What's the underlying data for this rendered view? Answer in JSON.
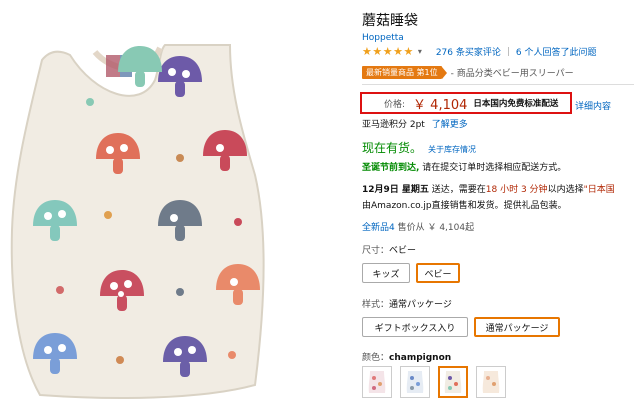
{
  "product": {
    "title": "蘑菇睡袋",
    "brand": "Hoppetta",
    "stars": "★★★★★",
    "reviews": "276 条买家评论",
    "qa": "6 个人回答了此问题",
    "badge": "最新销量商品 第1位",
    "rank_category": "- 商品分类ベビー用スリーパー",
    "price_label": "价格:",
    "price": "￥ 4,104",
    "shipping": "日本国内免费标准配送",
    "details_link": "详细内容",
    "points": "亚马逊积分 2pt",
    "points_link": "了解更多",
    "stock": "现在有货。",
    "stock_link": "关于库存情况",
    "xmas_label": "圣诞节前到达,",
    "xmas_text": "请在提交订单时选择相应配送方式。",
    "delivery_date": "12月9日 星期五",
    "delivery_text1": " 送达，需要在",
    "delivery_time": "18 小时 3 分钟",
    "delivery_text2": "以内选择",
    "delivery_option": "\"日本国",
    "delivery_line2": "由Amazon.co.jp直接销售和发货。提供礼品包装。",
    "offers_link": "全新品4",
    "offers_text": "售价从 ￥ 4,104起",
    "size_label": "尺寸：",
    "size_value": "ベビー",
    "size_options": [
      "キッズ",
      "ベビー"
    ],
    "style_label": "样式：",
    "style_value": "通常パッケージ",
    "style_options": [
      "ギフトボックス入り",
      "通常パッケージ"
    ],
    "color_label": "颜色：",
    "color_value": "champignon"
  },
  "colors": {
    "accent_orange": "#e77600",
    "badge_orange": "#e47911",
    "price_red": "#b12704",
    "link_blue": "#0066c0",
    "instock_green": "#008a00",
    "highlight_red": "#dd1111"
  },
  "icons": [
    "star-icon",
    "chevron-down-icon",
    "mushroom-icon",
    "sleep-sack-thumbnail-icon"
  ]
}
